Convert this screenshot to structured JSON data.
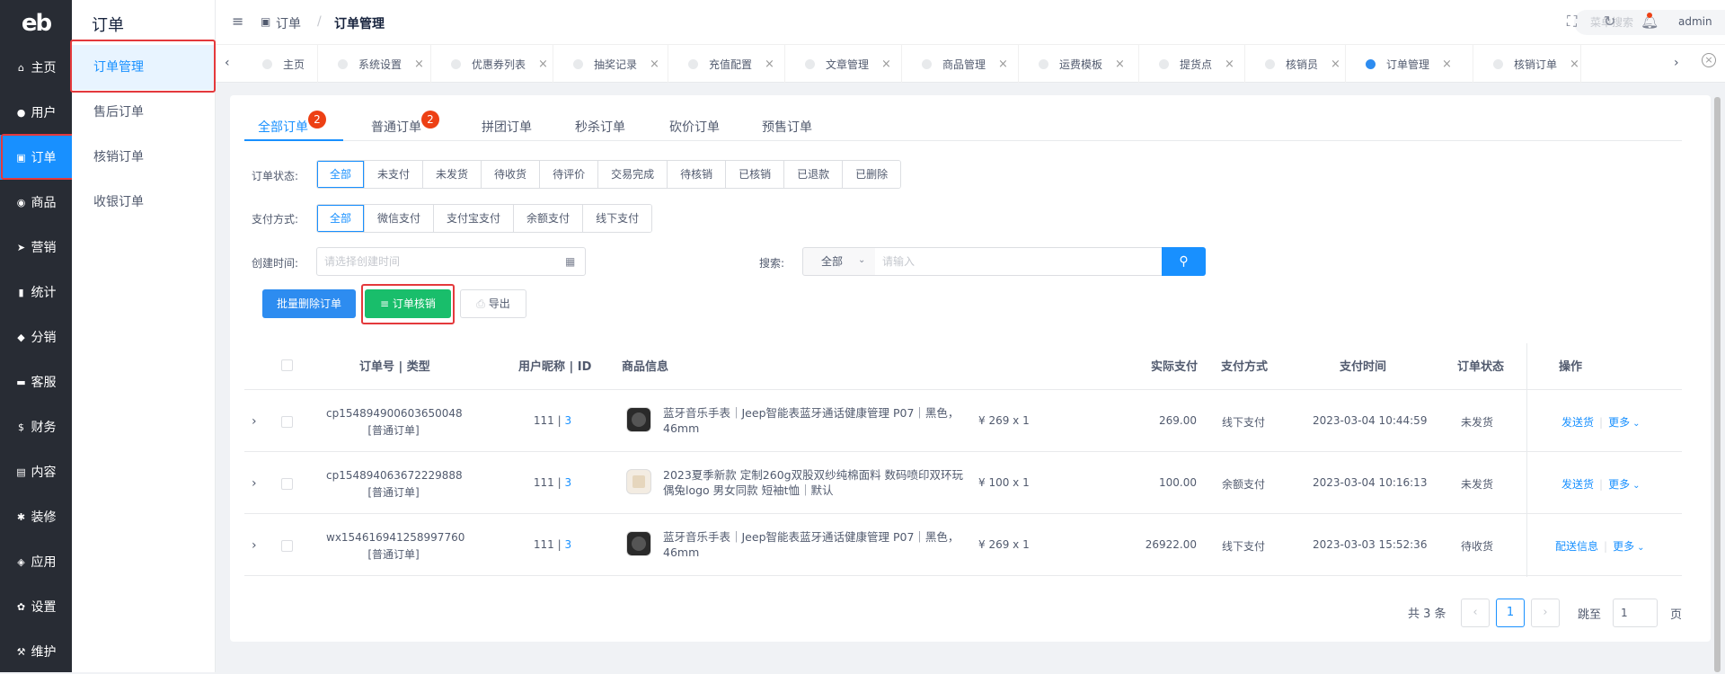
{
  "logo": "eb",
  "nav": [
    "主页",
    "用户",
    "订单",
    "商品",
    "营销",
    "统计",
    "分销",
    "客服",
    "财务",
    "内容",
    "装修",
    "应用",
    "设置",
    "维护"
  ],
  "nav_icons": [
    "home-icon",
    "user-icon",
    "cart-icon",
    "shop-icon",
    "send-icon",
    "stats-icon",
    "share-icon",
    "chat-icon",
    "money-icon",
    "book-icon",
    "brush-icon",
    "cube-icon",
    "gear-icon",
    "wrench-icon"
  ],
  "nav_glyphs": [
    "⌂",
    "●",
    "▣",
    "◉",
    "➤",
    "▮",
    "◆",
    "▬",
    "$",
    "▤",
    "✱",
    "◈",
    "✿",
    "⚒"
  ],
  "subnav": {
    "title": "订单",
    "items": [
      "订单管理",
      "售后订单",
      "核销订单",
      "收银订单"
    ]
  },
  "header": {
    "menu_icon": "≡",
    "crumb1": "订单",
    "sep": "/",
    "crumb2": "订单管理",
    "search_placeholder": "菜单搜索",
    "user": "admin"
  },
  "tags": [
    "主页",
    "系统设置",
    "优惠券列表",
    "抽奖记录",
    "充值配置",
    "文章管理",
    "商品管理",
    "运费模板",
    "提货点",
    "核销员",
    "订单管理",
    "核销订单"
  ],
  "tabs": [
    "全部订单",
    "普通订单",
    "拼团订单",
    "秒杀订单",
    "砍价订单",
    "预售订单"
  ],
  "tab_badges": [
    "2",
    "2"
  ],
  "filters": {
    "status_label": "订单状态:",
    "status": [
      "全部",
      "未支付",
      "未发货",
      "待收货",
      "待评价",
      "交易完成",
      "待核销",
      "已核销",
      "已退款",
      "已删除"
    ],
    "pay_label": "支付方式:",
    "pay": [
      "全部",
      "微信支付",
      "支付宝支付",
      "余额支付",
      "线下支付"
    ],
    "time_label": "创建时间:",
    "time_placeholder": "请选择创建时间",
    "search_label": "搜索:",
    "search_select": "全部",
    "search_placeholder": "请输入"
  },
  "actions": {
    "batch_delete": "批量删除订单",
    "verify": "订单核销",
    "export": "导出"
  },
  "table": {
    "headers": [
      "订单号 | 类型",
      "用户昵称 | ID",
      "商品信息",
      "实际支付",
      "支付方式",
      "支付时间",
      "订单状态",
      "操作"
    ],
    "rows": [
      {
        "order_no": "cp154894900603650048",
        "type": "[普通订单]",
        "nick": "111",
        "id": "3",
        "goods": "蓝牙音乐手表｜Jeep智能表蓝牙通话健康管理 P07｜黑色，46mm",
        "price": "¥ 269 x 1",
        "paid": "269.00",
        "method": "线下支付",
        "time": "2023-03-04 10:44:59",
        "status": "未发货",
        "op": "发送货",
        "more": "更多"
      },
      {
        "order_no": "cp154894063672229888",
        "type": "[普通订单]",
        "nick": "111",
        "id": "3",
        "goods": "2023夏季新款 定制260g双股双纱纯棉面料 数码喷印双环玩偶兔logo 男女同款 短袖t恤｜默认",
        "price": "¥ 100 x 1",
        "paid": "100.00",
        "method": "余额支付",
        "time": "2023-03-04 10:16:13",
        "status": "未发货",
        "op": "发送货",
        "more": "更多"
      },
      {
        "order_no": "wx154616941258997760",
        "type": "[普通订单]",
        "nick": "111",
        "id": "3",
        "goods": "蓝牙音乐手表｜Jeep智能表蓝牙通话健康管理 P07｜黑色，46mm",
        "price": "¥ 269 x 1",
        "paid": "26922.00",
        "method": "线下支付",
        "time": "2023-03-03 15:52:36",
        "status": "待收货",
        "op": "配送信息",
        "more": "更多"
      }
    ]
  },
  "pagination": {
    "total": "共 3 条",
    "page": "1",
    "jump_label": "跳至",
    "jump_value": "1",
    "page_unit": "页"
  },
  "colors": {
    "primary": "#1890ff",
    "nav_bg": "#282c34",
    "success": "#19be6b",
    "danger": "#e4393c"
  }
}
